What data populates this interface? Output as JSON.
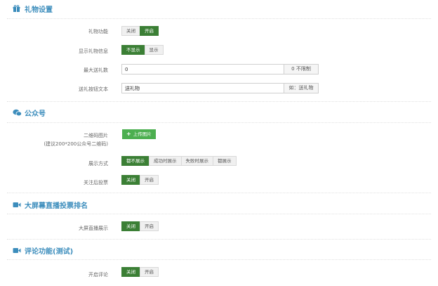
{
  "gift": {
    "title": "礼物设置",
    "function_label": "礼物功能",
    "function_options": [
      "关闭",
      "开启"
    ],
    "show_info_label": "显示礼物信息",
    "show_info_options": [
      "不显示",
      "显示"
    ],
    "max_label": "最大送礼数",
    "max_value": "0",
    "max_suffix": "0 不限制",
    "btn_text_label": "送礼按钮文本",
    "btn_text_value": "送礼物",
    "btn_text_suffix": "如：送礼物"
  },
  "official": {
    "title": "公众号",
    "qr_label": "二维码图片",
    "qr_hint": "(建议200*200公众号二维码)",
    "upload_label": "上传图片",
    "display_label": "展示方式",
    "display_options": [
      "都不展示",
      "成功时展示",
      "失败时展示",
      "都展示"
    ],
    "vote_label": "关注后投票",
    "vote_options": [
      "关闭",
      "开启"
    ]
  },
  "bigscreen": {
    "title": "大屏幕直播投票排名",
    "live_label": "大屏直播展示",
    "live_options": [
      "关闭",
      "开启"
    ]
  },
  "comment": {
    "title": "评论功能(测试)",
    "enable_label": "开启评论",
    "enable_options": [
      "关闭",
      "开启"
    ]
  },
  "colors": {
    "accent": "#3c8dbc",
    "active_green": "#3b7f35",
    "upload_green": "#4caf50"
  },
  "icons": {
    "gift": "gift-icon",
    "official": "wechat-icon",
    "bigscreen": "video-icon",
    "comment": "video-icon"
  }
}
